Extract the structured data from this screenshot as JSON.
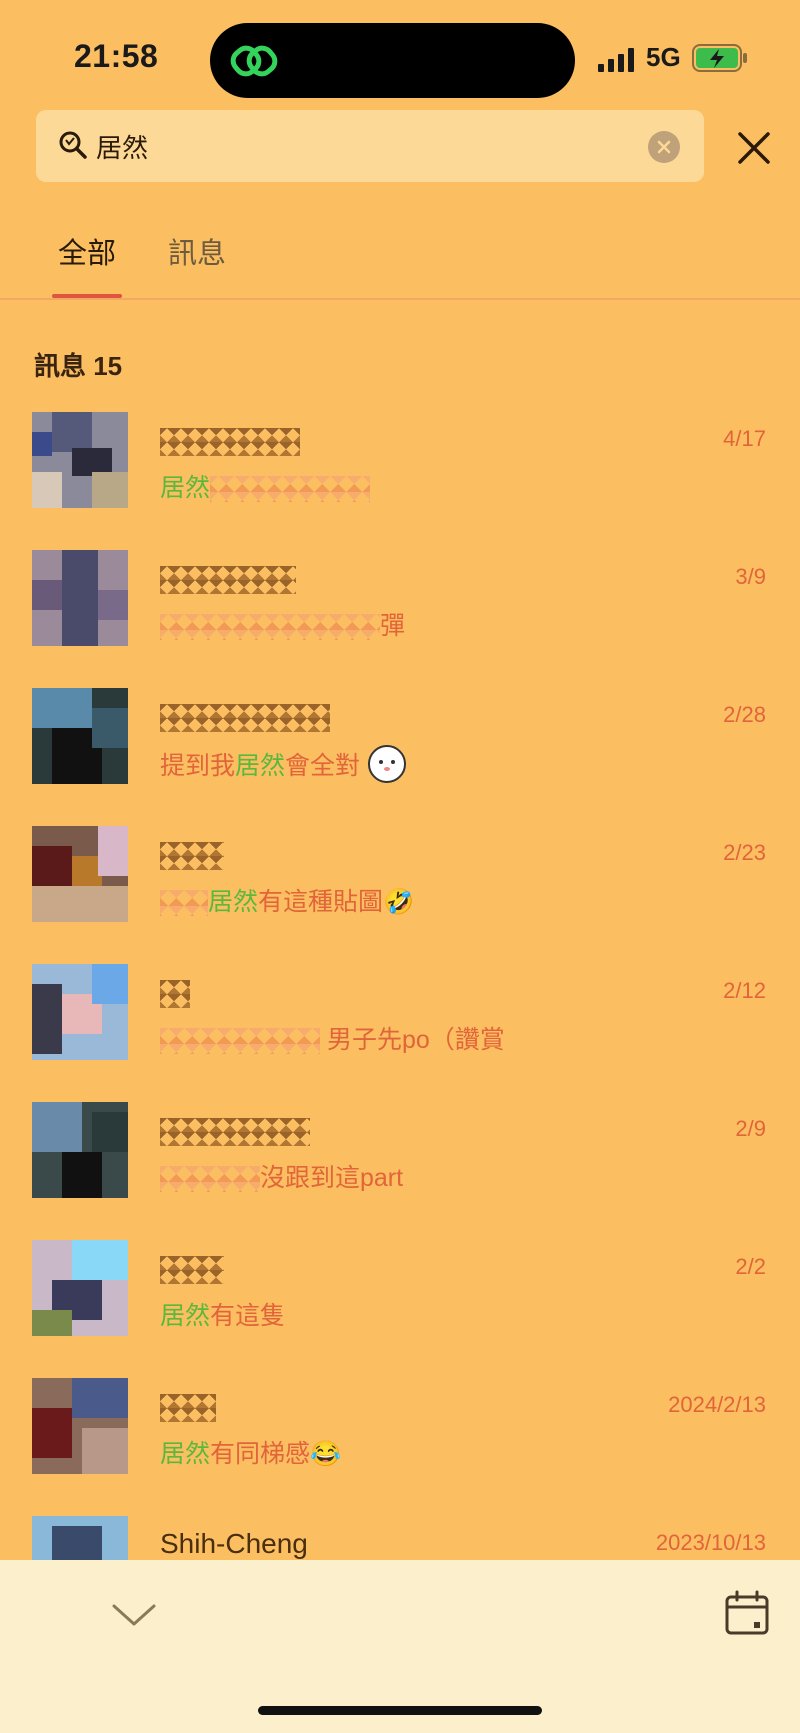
{
  "status": {
    "time": "21:58",
    "network": "5G"
  },
  "search": {
    "value": "居然"
  },
  "tabs": [
    {
      "label": "全部"
    },
    {
      "label": "訊息"
    }
  ],
  "section": {
    "title": "訊息 15"
  },
  "results": [
    {
      "name": "",
      "snippet_pre": "",
      "highlight": "居然",
      "snippet_post": "",
      "date": "4/17"
    },
    {
      "name": "",
      "snippet_pre": "",
      "highlight": "",
      "snippet_post": "彈",
      "date": "3/9"
    },
    {
      "name": "",
      "snippet_pre": "提到我",
      "highlight": "居然",
      "snippet_post": "會全對",
      "date": "2/28"
    },
    {
      "name": "",
      "snippet_pre": "",
      "highlight": "居然",
      "snippet_post": "有這種貼圖🤣",
      "date": "2/23"
    },
    {
      "name": "",
      "snippet_pre": "",
      "highlight": "",
      "snippet_post": "男子先po（讚賞",
      "date": "2/12"
    },
    {
      "name": "",
      "snippet_pre": "",
      "highlight": "",
      "snippet_post": "沒跟到這part",
      "date": "2/9"
    },
    {
      "name": "",
      "snippet_pre": "",
      "highlight": "居然",
      "snippet_post": "有這隻",
      "date": "2/2"
    },
    {
      "name": "",
      "snippet_pre": "",
      "highlight": "居然",
      "snippet_post": "有同梯感😂",
      "date": "2024/2/13"
    },
    {
      "name": "Shih-Cheng",
      "snippet_pre": "",
      "highlight": "",
      "snippet_post": "",
      "date": "2023/10/13"
    }
  ],
  "colors": {
    "background": "#FBBF62",
    "accent": "#E2643A",
    "highlight": "#5BB83C",
    "tab_indicator": "#E0553E",
    "bottom_bar": "#FCEFCB"
  },
  "icons": {
    "app_logo": "line-chain-icon",
    "search": "search-icon",
    "clear": "clear-icon",
    "close": "close-icon",
    "collapse": "chevron-down-icon",
    "calendar": "calendar-icon"
  }
}
